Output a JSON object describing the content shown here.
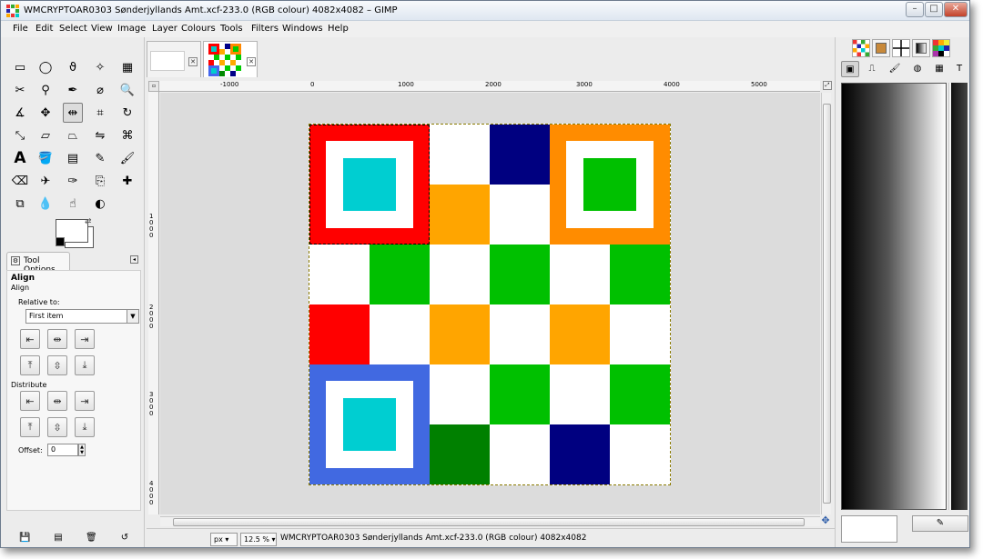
{
  "window": {
    "title": "WMCRYPTOAR0303 Sønderjyllands Amt.xcf-233.0 (RGB colour) 4082x4082 – GIMP",
    "minimize": "–",
    "maximize": "□",
    "close": "✕"
  },
  "menu": [
    "File",
    "Edit",
    "Select",
    "View",
    "Image",
    "Layer",
    "Colours",
    "Tools",
    "Filters",
    "Windows",
    "Help"
  ],
  "tools": [
    "rect-select",
    "ellipse-select",
    "free-select",
    "fuzzy-select",
    "by-color-select",
    "scissors-select",
    "foreground-select",
    "paths",
    "color-picker",
    "zoom",
    "measure",
    "move",
    "align",
    "crop",
    "rotate",
    "scale",
    "shear",
    "perspective",
    "flip",
    "cage-transform",
    "text",
    "bucket-fill",
    "blend",
    "pencil",
    "paintbrush",
    "eraser",
    "airbrush",
    "ink",
    "clone",
    "heal",
    "perspective-clone",
    "blur",
    "smudge",
    "dodge-burn"
  ],
  "tool_options": {
    "tab_label": "Tool Options",
    "title": "Align",
    "subtitle": "Align",
    "relative_label": "Relative to:",
    "relative_value": "First item",
    "distribute_label": "Distribute",
    "offset_label": "Offset:",
    "offset_value": "0"
  },
  "ruler": {
    "h_labels": [
      "-1000",
      "0",
      "1000",
      "2000",
      "3000",
      "4000",
      "5000"
    ],
    "v_labels": [
      "1000",
      "2000",
      "3000",
      "4000"
    ]
  },
  "status": {
    "unit": "px",
    "zoom": "12.5 %",
    "text": "WMCRYPTOAR0303 Sønderjyllands Amt.xcf-233.0 (RGB colour) 4082x4082"
  },
  "colors": {
    "red": "#ff0000",
    "orange": "#ffa500",
    "dark_orange": "#ff8c00",
    "navy": "#000080",
    "green": "#00c000",
    "dark_green": "#008000",
    "cyan": "#00ced1",
    "blue": "#4169e1",
    "white": "#ffffff"
  },
  "image_grid": [
    [
      "red",
      "red",
      "white",
      "navy",
      "dark_orange",
      "dark_orange"
    ],
    [
      "red",
      "red",
      "orange",
      "white",
      "dark_orange",
      "dark_orange"
    ],
    [
      "white",
      "green",
      "white",
      "green",
      "white",
      "green"
    ],
    [
      "red",
      "white",
      "orange",
      "white",
      "orange",
      "white"
    ],
    [
      "blue",
      "blue",
      "white",
      "green",
      "white",
      "green"
    ],
    [
      "blue",
      "blue",
      "dark_green",
      "white",
      "navy",
      "white"
    ]
  ],
  "finder_patterns": [
    {
      "row": 0,
      "col": 0,
      "outer": "red",
      "inner": "cyan"
    },
    {
      "row": 0,
      "col": 4,
      "outer": "dark_orange",
      "inner": "green"
    },
    {
      "row": 4,
      "col": 0,
      "outer": "blue",
      "inner": "cyan"
    }
  ]
}
